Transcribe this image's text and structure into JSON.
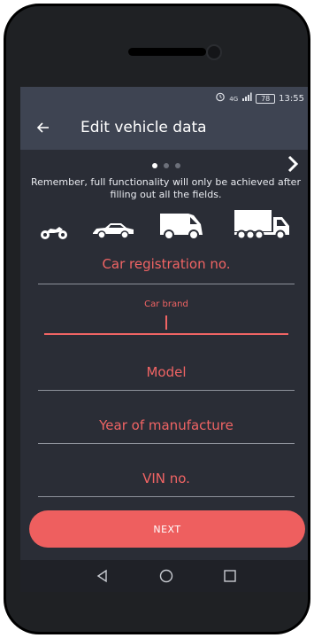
{
  "status_bar": {
    "alarm_icon": "alarm-icon",
    "network_text": "4G",
    "battery_level": "78",
    "time": "13:55"
  },
  "app_bar": {
    "title": "Edit vehicle data",
    "back_icon": "arrow-left-icon"
  },
  "stepper": {
    "total_dots": 3,
    "active_index": 0,
    "next_icon": "chevron-right-icon"
  },
  "notice": {
    "text": "Remember, full functionality will only be achieved after filling out all the fields."
  },
  "vehicle_types": [
    "motorcycle-icon",
    "car-icon",
    "van-icon",
    "truck-icon"
  ],
  "form": {
    "registration_label": "Car registration no.",
    "brand_label": "Car brand",
    "brand_value": "",
    "model_label": "Model",
    "year_label": "Year of manufacture",
    "vin_label": "VIN no."
  },
  "actions": {
    "next_label": "NEXT"
  },
  "colors": {
    "accent": "#ee5f5f",
    "appbar": "#3e4452",
    "background": "#2a2d36"
  }
}
